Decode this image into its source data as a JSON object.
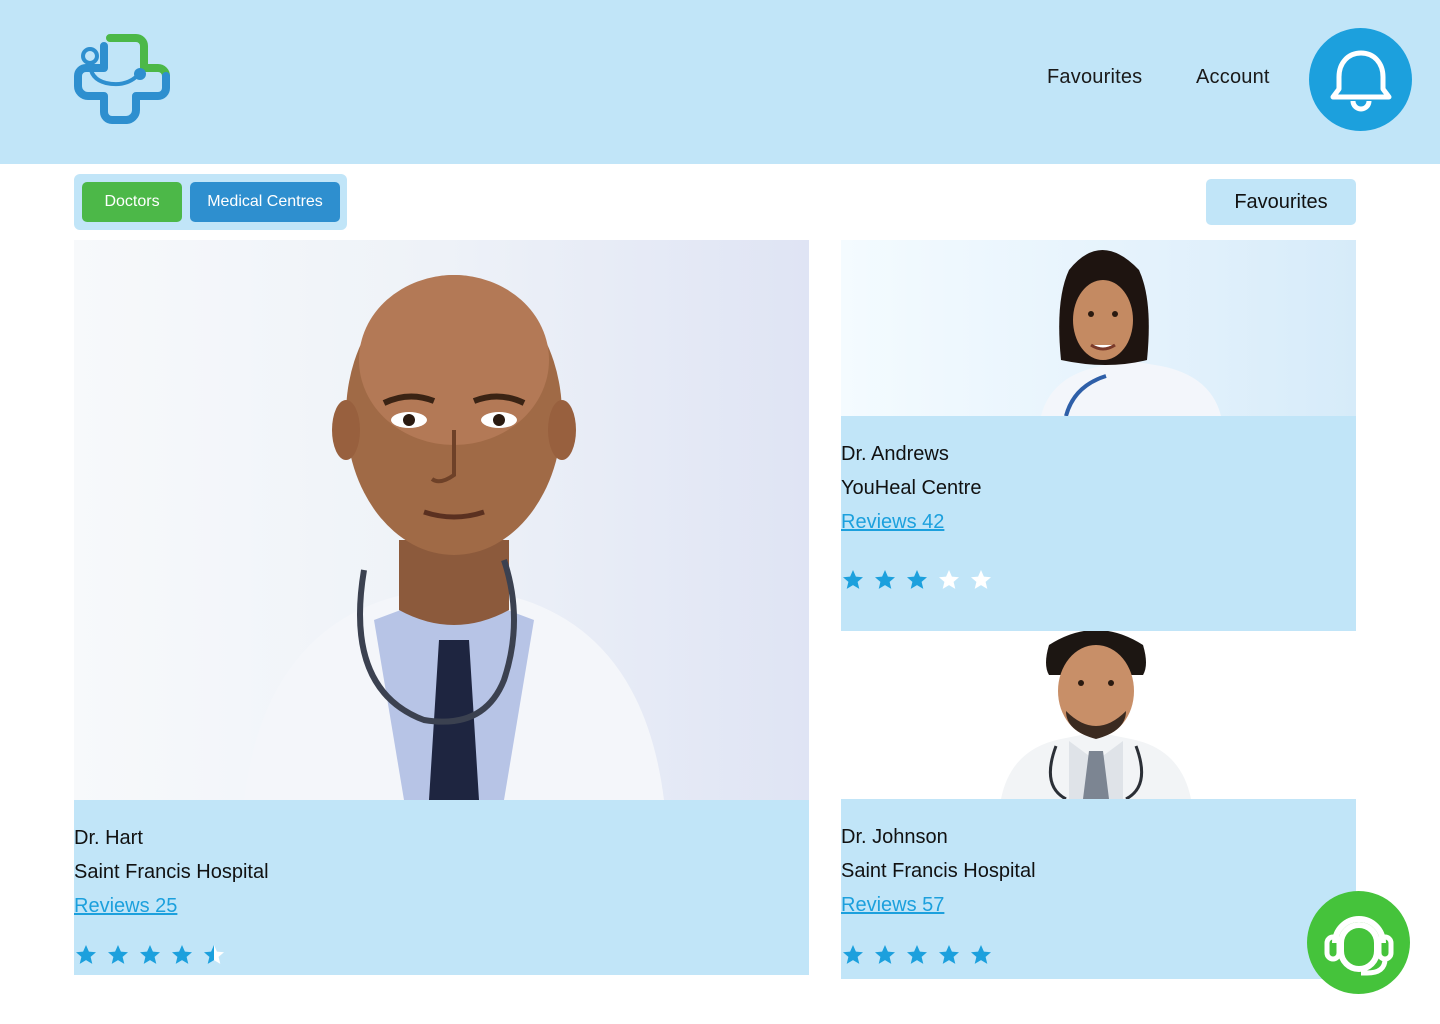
{
  "nav": {
    "favourites": "Favourites",
    "account": "Account"
  },
  "tabs": {
    "doctors": "Doctors",
    "medical_centres": "Medical Centres"
  },
  "favourites_button": "Favourites",
  "doctors": [
    {
      "name": "Dr. Hart",
      "hospital": "Saint Francis Hospital",
      "reviews": "Reviews 25",
      "rating": 4.5
    },
    {
      "name": "Dr. Andrews",
      "hospital": "YouHeal Centre",
      "reviews": "Reviews 42",
      "rating": 3
    },
    {
      "name": "Dr. Johnson",
      "hospital": "Saint Francis Hospital",
      "reviews": "Reviews 57",
      "rating": 5
    }
  ],
  "colors": {
    "header_bg": "#c1e5f8",
    "accent_blue": "#1ca0dd",
    "green": "#4cb848",
    "tab_blue": "#2e8fcf"
  },
  "icons": {
    "logo": "medical-cross-stethoscope-logo",
    "bell": "bell-icon",
    "support": "headset-icon",
    "star": "star-icon"
  }
}
